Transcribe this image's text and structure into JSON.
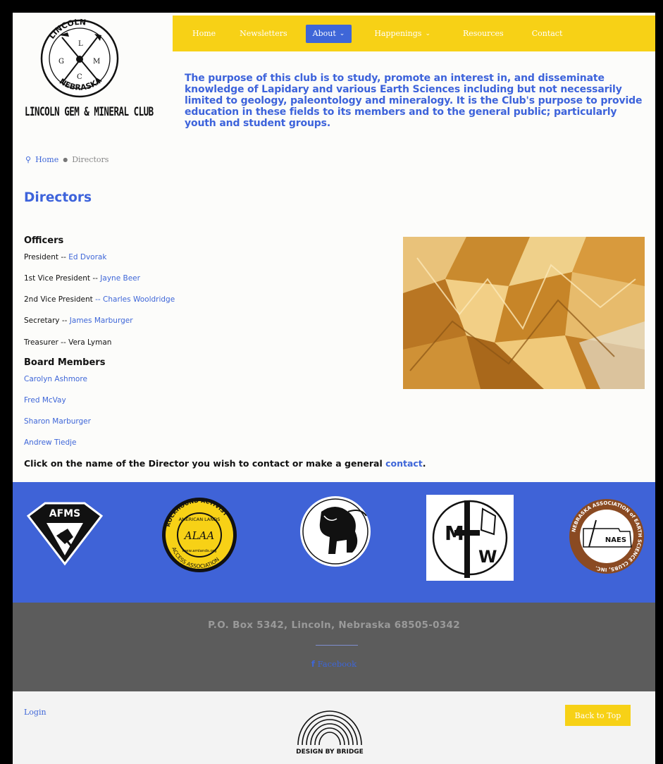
{
  "logo": {
    "arc_top": "LINCOLN",
    "letters": [
      "L",
      "G",
      "M",
      "C"
    ],
    "arc_bottom": "NEBRASKA",
    "name": "LINCOLN GEM & MINERAL CLUB"
  },
  "nav": {
    "items": [
      {
        "label": "Home"
      },
      {
        "label": "Newsletters"
      },
      {
        "label": "About",
        "active": true,
        "chevron": true
      },
      {
        "label": "Happenings",
        "chevron": true
      },
      {
        "label": "Resources"
      },
      {
        "label": "Contact"
      }
    ]
  },
  "mission": "The purpose of this club is to study, promote an interest in, and disseminate knowledge of Lapidary and various Earth Sciences including but not necessarily limited to geology, paleontology and mineralogy. It is the Club's purpose to provide education in these fields to its members and to the general public; particularly youth and student groups.",
  "breadcrumb": {
    "home": "Home",
    "current": "Directors"
  },
  "page_title": "Directors",
  "officers": {
    "heading": "Officers",
    "items": [
      {
        "role": "President",
        "sep": " -- ",
        "name": "Ed Dvorak",
        "link": true
      },
      {
        "role": "1st Vice President",
        "sep": " -- ",
        "name": "Jayne Beer",
        "link": true
      },
      {
        "role": "2nd Vice President",
        "sep": " -- ",
        "name": "Charles Wooldridge",
        "link": true
      },
      {
        "role": "Secretary",
        "sep": " -- ",
        "name": "James Marburger",
        "link": true
      },
      {
        "role": "Treasurer",
        "sep": " -- ",
        "name": "Vera Lyman",
        "link": false
      }
    ]
  },
  "board": {
    "heading": "Board Members",
    "members": [
      "Carolyn Ashmore",
      "Fred McVay",
      "Sharon Marburger",
      "Andrew Tiedje"
    ]
  },
  "note": {
    "text": "Click on the name of the Director you wish to contact or make a general ",
    "link": "contact",
    "end": "."
  },
  "orgs": {
    "afms": "AFMS",
    "alaa_top": "ROCKHOUND ACTIVIST",
    "alaa_mid": "AMERICAN LANDS",
    "alaa_core": "ALAA",
    "alaa_bottom": "ACCESS ASSOCIATION",
    "alaa_url": "www.amlands.org",
    "mwf_letters": [
      "M",
      "W"
    ],
    "naes_arc": "NEBRASKA ASSOCIATION of EARTH SCIENCE CLUBS, INC.",
    "naes_core": "NAES"
  },
  "footer": {
    "address": "P.O. Box 5342, Lincoln, Nebraska 68505-0342",
    "facebook_label": "Facebook"
  },
  "bottom": {
    "login": "Login",
    "designer": "DESIGN BY BRIDGE",
    "back_to_top": "Back to Top"
  },
  "colors": {
    "accent": "#3e66d8",
    "nav": "#f7d116",
    "band": "#3f63d7",
    "footer": "#5c5c5c"
  }
}
